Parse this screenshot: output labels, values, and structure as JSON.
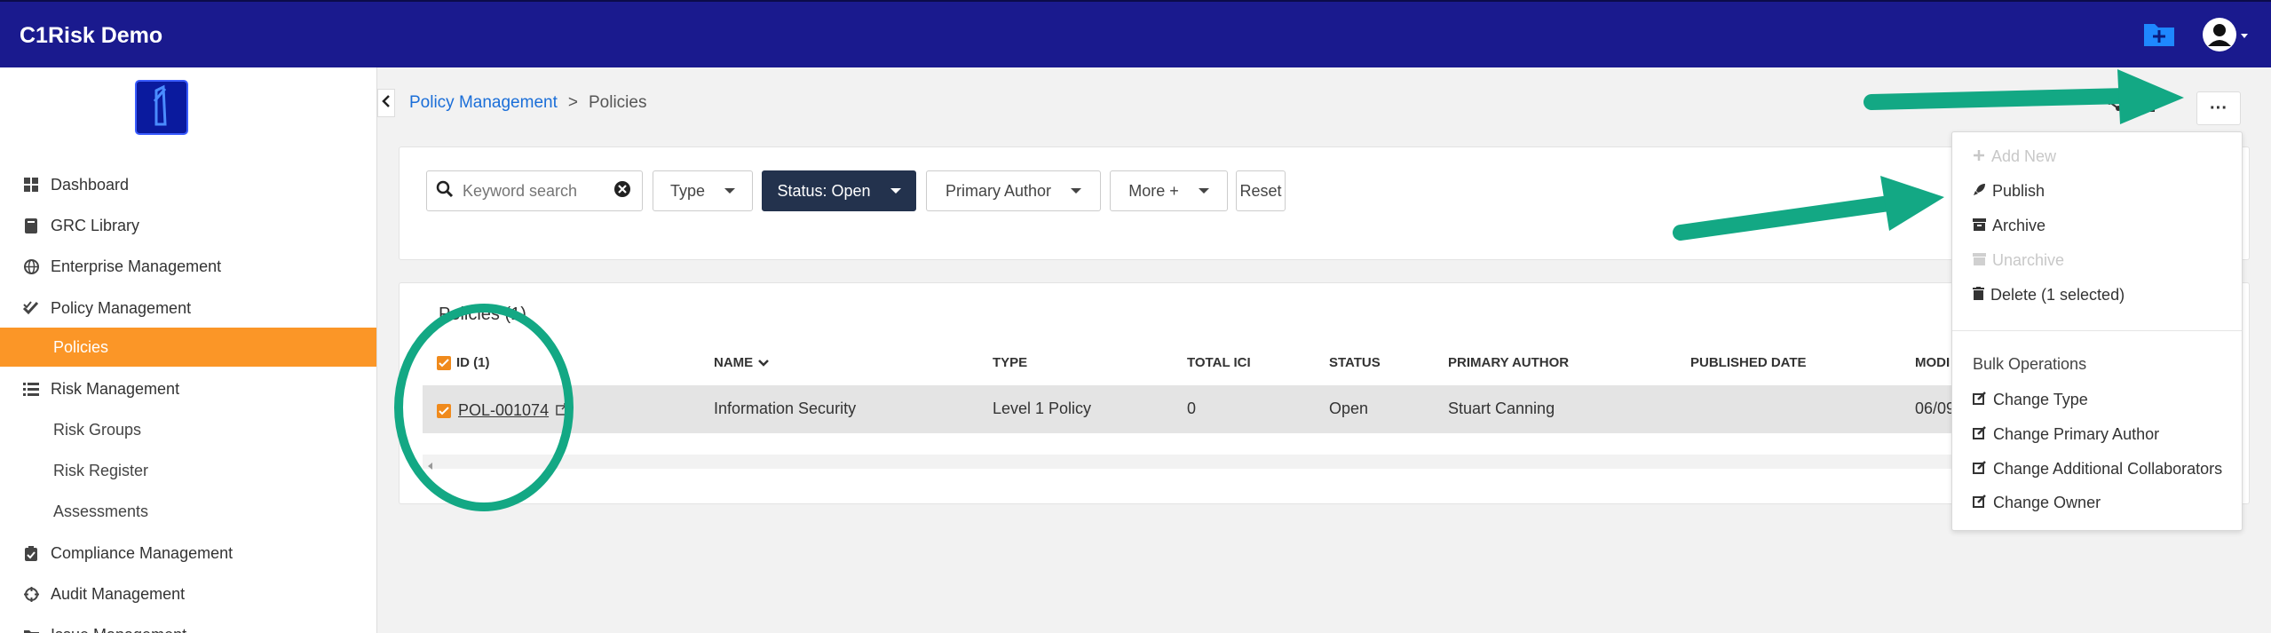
{
  "app": {
    "title": "C1Risk Demo"
  },
  "sidebar": {
    "items": [
      {
        "label": "Dashboard",
        "icon": "dashboard-icon"
      },
      {
        "label": "GRC Library",
        "icon": "book-icon"
      },
      {
        "label": "Enterprise Management",
        "icon": "globe-icon"
      },
      {
        "label": "Policy Management",
        "icon": "double-check-icon"
      },
      {
        "label": "Policies",
        "icon": ""
      },
      {
        "label": "Risk Management",
        "icon": "list-icon"
      },
      {
        "label": "Risk Groups",
        "icon": ""
      },
      {
        "label": "Risk Register",
        "icon": ""
      },
      {
        "label": "Assessments",
        "icon": ""
      },
      {
        "label": "Compliance Management",
        "icon": "clipboard-check-icon"
      },
      {
        "label": "Audit Management",
        "icon": "crosshair-icon"
      },
      {
        "label": "Issue Management",
        "icon": "folder-icon"
      }
    ]
  },
  "breadcrumb": {
    "parent": "Policy Management",
    "separator": ">",
    "current": "Policies"
  },
  "filters": {
    "search_placeholder": "Keyword search",
    "type": "Type",
    "status": "Status: Open",
    "primary_author": "Primary Author",
    "more": "More +",
    "reset": "Reset"
  },
  "table": {
    "title": "Policies (1)",
    "headers": {
      "id": "ID (1)",
      "name": "NAME",
      "type": "TYPE",
      "total_ici": "TOTAL ICI",
      "status": "STATUS",
      "primary_author": "PRIMARY AUTHOR",
      "published_date": "PUBLISHED DATE",
      "modified": "MODI"
    },
    "rows": [
      {
        "id": "POL-001074",
        "name": "Information Security",
        "type": "Level 1 Policy",
        "total_ici": "0",
        "status": "Open",
        "primary_author": "Stuart Canning",
        "modified": "06/09"
      }
    ]
  },
  "menu": {
    "add_new": "Add New",
    "publish": "Publish",
    "archive": "Archive",
    "unarchive": "Unarchive",
    "delete": "Delete (1 selected)",
    "bulk_header": "Bulk Operations",
    "change_type": "Change Type",
    "change_primary_author": "Change Primary Author",
    "change_additional_collaborators": "Change Additional Collaborators",
    "change_owner": "Change Owner",
    "more_icon": "···"
  },
  "colors": {
    "topbar": "#1a1a8e",
    "accent": "#fb9627",
    "status_button": "#23324d",
    "link": "#1a6ed8",
    "annotation": "#13a884"
  }
}
